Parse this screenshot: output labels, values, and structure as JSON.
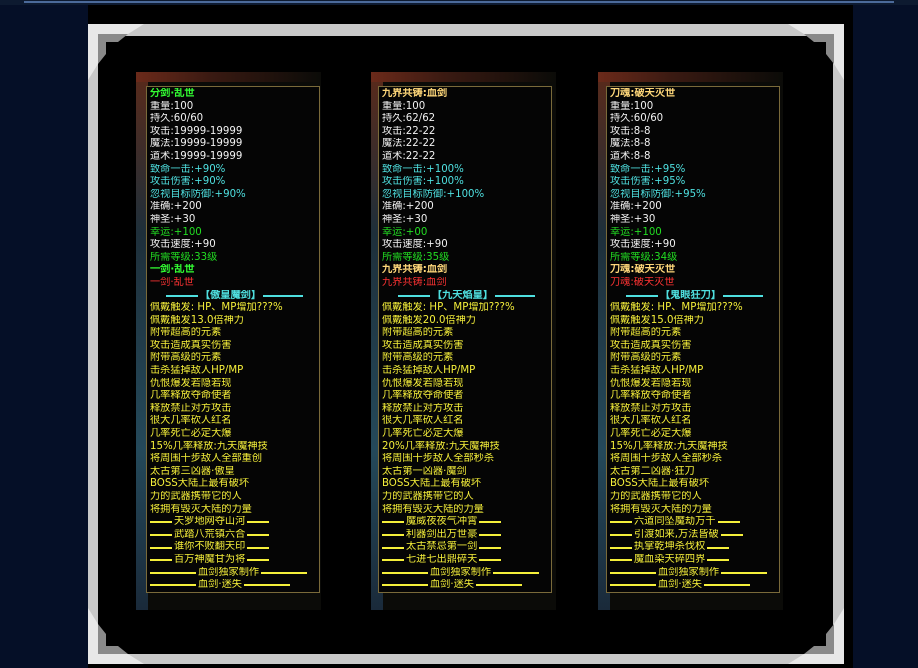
{
  "panels": [
    {
      "title": "分剑·乱世",
      "title_class": "green",
      "stats": [
        "重量:100",
        "持久:60/60",
        "攻击:19999-19999",
        "魔法:19999-19999",
        "道术:19999-19999"
      ],
      "bonus": [
        "致命一击:+90%",
        "攻击伤害:+90%",
        "忽视目标防御:+90%"
      ],
      "stats2": [
        "准确:+200",
        "神圣:+30"
      ],
      "luck": "幸运:+100",
      "speed": "攻击速度:+90",
      "level": "所需等级:33级",
      "name2": "一剑·乱世",
      "name2_class": "green",
      "name3": "一剑·乱世",
      "set_header": "【傲皇魔剑】",
      "effects": [
        "佩戴触发: HP、MP增加???%",
        "佩戴触发13.0倍神力",
        "附带超高的元素",
        "攻击造成真实伤害",
        "附带高级的元素",
        "击杀猛掉敌人HP/MP",
        "仇恨爆发若隐若现",
        "几率释放夺命使者",
        "释放禁止对方攻击",
        "很大几率砍人红名",
        "几率死亡必定大爆",
        "15%几率释放:九天魔神技",
        "将周围十步敌人全部重创",
        "太古第三凶器·傲皇",
        "BOSS大陆上最有破坏",
        "力的武器携带它的人",
        "将拥有毁灭大陆的力量"
      ],
      "poems": [
        "天罗地网夺山河",
        "武踏八荒镇六合",
        "谁你不败翻天印",
        "百万神魔甘为将"
      ],
      "footer": [
        "血剑独家制作",
        "血剑·迷失"
      ]
    },
    {
      "title": "九界共铸:血剑",
      "title_class": "gold",
      "stats": [
        "重量:100",
        "持久:62/62",
        "攻击:22-22",
        "魔法:22-22",
        "道术:22-22"
      ],
      "bonus": [
        "致命一击:+100%",
        "攻击伤害:+100%",
        "忽视目标防御:+100%"
      ],
      "stats2": [
        "准确:+200",
        "神圣:+30"
      ],
      "luck": "幸运:+00",
      "speed": "攻击速度:+90",
      "level": "所需等级:35级",
      "name2": "九界共铸:血剑",
      "name2_class": "gold",
      "name3": "九界共铸:血剑",
      "set_header": "【九天焰皇】",
      "effects": [
        "佩戴触发: HP、MP增加???%",
        "佩戴触发20.0倍神力",
        "附带超高的元素",
        "攻击造成真实伤害",
        "附带高级的元素",
        "击杀猛掉敌人HP/MP",
        "仇恨爆发若隐若现",
        "几率释放夺命使者",
        "释放禁止对方攻击",
        "很大几率砍人红名",
        "几率死亡必定大爆",
        "20%几率释放:九天魔神技",
        "将周围十步敌人全部秒杀",
        "太古第一凶器·魔剑",
        "BOSS大陆上最有破坏",
        "力的武器携带它的人",
        "将拥有毁灭大陆的力量"
      ],
      "poems": [
        "魔威夜夜气冲霄",
        "利器剑出万世豪",
        "太古禁忌第一剑",
        "七进七出鼎碎天"
      ],
      "footer": [
        "血剑独家制作",
        "血剑·迷失"
      ]
    },
    {
      "title": "刀魂:破天灭世",
      "title_class": "gold",
      "stats": [
        "重量:100",
        "持久:60/60",
        "攻击:8-8",
        "魔法:8-8",
        "道术:8-8"
      ],
      "bonus": [
        "致命一击:+95%",
        "攻击伤害:+95%",
        "忽视目标防御:+95%"
      ],
      "stats2": [
        "准确:+200",
        "神圣:+30"
      ],
      "luck": "幸运:+100",
      "speed": "攻击速度:+90",
      "level": "所需等级:34级",
      "name2": "刀魂:破天灭世",
      "name2_class": "gold",
      "name3": "刀魂:破天灭世",
      "set_header": "【鬼眼狂刀】",
      "effects": [
        "佩戴触发: HP、MP增加???%",
        "佩戴触发15.0倍神力",
        "附带超高的元素",
        "攻击造成真实伤害",
        "附带高级的元素",
        "击杀猛掉敌人HP/MP",
        "仇恨爆发若隐若现",
        "几率释放夺命使者",
        "释放禁止对方攻击",
        "很大几率砍人红名",
        "几率死亡必定大爆",
        "15%几率释放:九天魔神技",
        "将周围十步敌人全部秒杀",
        "太古第二凶器·狂刀",
        "BOSS大陆上最有破坏",
        "力的武器携带它的人",
        "将拥有毁灭大陆的力量"
      ],
      "poems": [
        "六道同坠魔劫万千",
        "引渡如来,万法皆破",
        "执掌乾坤杀伐权",
        "魔血染天碎四界"
      ],
      "footer": [
        "血剑独家制作",
        "血剑·迷失"
      ]
    }
  ]
}
